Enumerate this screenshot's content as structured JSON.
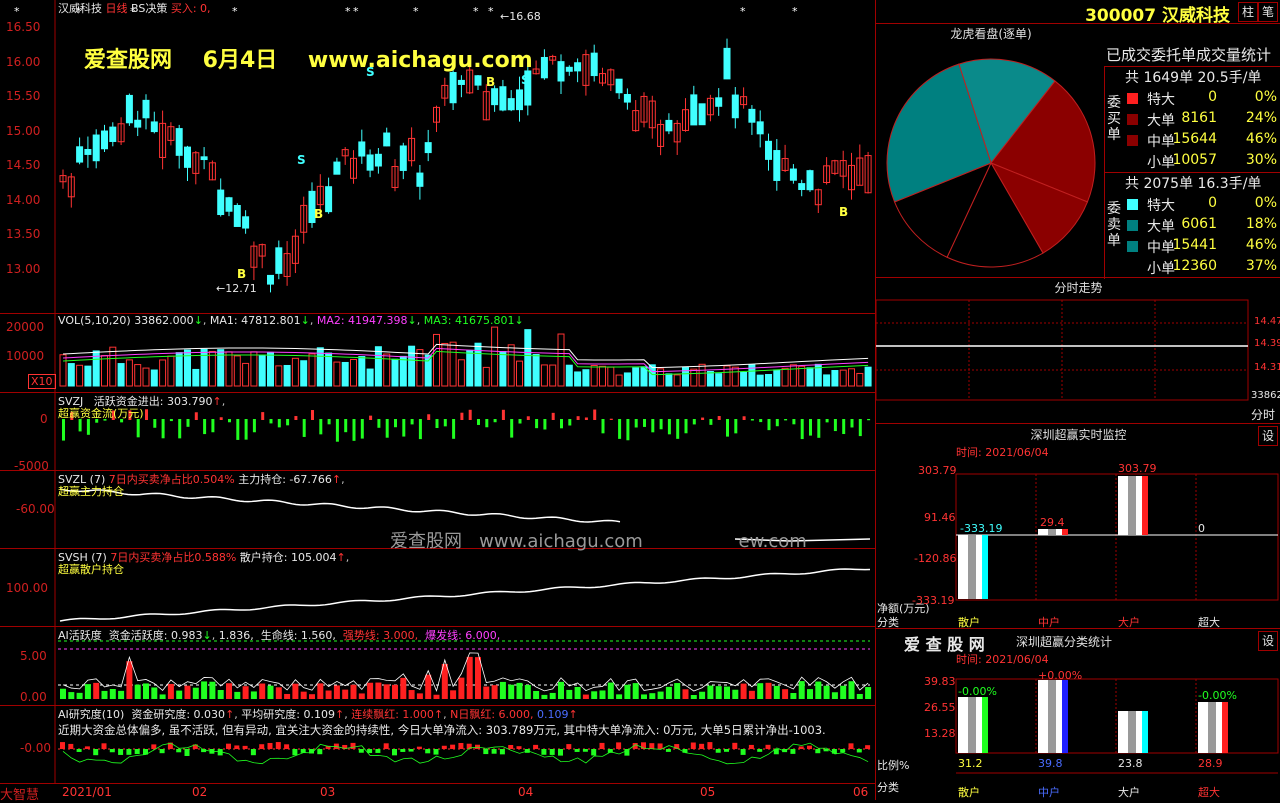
{
  "main_chart": {
    "stock_name": "汉威科技",
    "period": "日线",
    "indicator": "BS决策",
    "buy_label": "买入: 0,",
    "high_marker": "16.68",
    "low_marker": "12.71",
    "y_ticks": [
      "16.50",
      "16.00",
      "15.50",
      "15.00",
      "14.50",
      "14.00",
      "13.50",
      "13.00"
    ],
    "watermark_site": "爱查股网",
    "watermark_date": "6月4日",
    "watermark_url": "www.aichagu.com",
    "signal_b": "B",
    "signal_s": "S"
  },
  "vol_pane": {
    "label": "VOL(5,10,20)",
    "value": "33862.000",
    "ma1": "MA1: 47812.801",
    "ma2": "MA2: 41947.398",
    "ma3": "MA3: 41675.801",
    "y_ticks": [
      "20000",
      "10000"
    ],
    "unit": "X10"
  },
  "svzj_pane": {
    "label": "SVZJ",
    "field": "活跃资金进出: 303.790",
    "sub": "超赢资金流(万元)",
    "y_ticks": [
      "0",
      "-5000"
    ]
  },
  "svzl_pane": {
    "label": "SVZL (7)",
    "field1": "7日内买卖净占比0.504%",
    "field2": "主力持仓: -67.766",
    "sub": "超赢主力持仓",
    "y_ticks": [
      "-60.00"
    ],
    "watermark_site": "爱查股网",
    "watermark_url": "www.aichagu.com",
    "watermark_tail": "ew.com"
  },
  "svsh_pane": {
    "label": "SVSH (7)",
    "field1": "7日内买卖净占比0.588%",
    "field2": "散户持仓: 105.004",
    "sub": "超赢散户持仓",
    "y_ticks": [
      "100.00"
    ]
  },
  "ai_active": {
    "label": "AI活跃度",
    "f1": "资金活跃度: 0.983",
    "f2": "1.836,",
    "f3": "生命线: 1.560,",
    "f4": "强势线: 3.000,",
    "f5": "爆发线: 6.000,",
    "y_ticks": [
      "5.00",
      "0.00"
    ]
  },
  "ai_research": {
    "label": "AI研究度(10)",
    "f1": "资金研究度: 0.030",
    "f2": "平均研究度: 0.109",
    "f3": "连续飘红: 1.000",
    "f4": "N日飘红: 6.000,",
    "f5": "0.109",
    "comment": "近期大资金总体偏多, 虽不活跃, 但有异动, 宜关注大资金的持续性, 今日大单净流入: 303.789万元, 其中特大单净流入: 0万元, 大单5日累计净出-1003.",
    "y_ticks": [
      "-0.00"
    ]
  },
  "x_axis": {
    "brand": "大智慧",
    "labels": [
      "2021/01",
      "02",
      "03",
      "04",
      "05",
      "06"
    ]
  },
  "right_panel": {
    "code": "300007",
    "name": "汉威科技",
    "btn1": "柱",
    "btn2": "笔",
    "lhb_title": "龙虎看盘(逐单)",
    "stat_title": "已成交委托单成交量统计",
    "buy": {
      "side_label": "委买单",
      "summary": "共 1649单 20.5手/单",
      "rows": [
        {
          "name": "特大",
          "value": "0",
          "pct": "0%"
        },
        {
          "name": "大单",
          "value": "8161",
          "pct": "24%"
        },
        {
          "name": "中单",
          "value": "15644",
          "pct": "46%"
        },
        {
          "name": "小单",
          "value": "10057",
          "pct": "30%"
        }
      ]
    },
    "sell": {
      "side_label": "委卖单",
      "summary": "共 2075单 16.3手/单",
      "rows": [
        {
          "name": "特大",
          "value": "0",
          "pct": "0%"
        },
        {
          "name": "大单",
          "value": "6061",
          "pct": "18%"
        },
        {
          "name": "中单",
          "value": "15441",
          "pct": "46%"
        },
        {
          "name": "小单",
          "value": "12360",
          "pct": "37%"
        }
      ]
    },
    "intraday_title": "分时走势",
    "intraday_ticks": [
      "14.47",
      "14.39",
      "14.31"
    ],
    "intraday_vol": "33862",
    "intraday_vol_unit": "分时",
    "monitor_title": "深圳超赢实时监控",
    "monitor_time": "时间: 2021/06/04",
    "monitor_ticks": [
      "303.79",
      "91.46",
      "-120.86",
      "-333.19"
    ],
    "monitor_values": {
      "small": "-333.19",
      "mid": "29.4",
      "large": "303.79",
      "super": "0"
    },
    "monitor_unit": "净额(万元)",
    "category_label": "分类",
    "categories": [
      "散户",
      "中户",
      "大户",
      "超大"
    ],
    "class_title": "深圳超赢分类统计",
    "class_brand": "爱 查 股 网",
    "class_time": "时间: 2021/06/04",
    "class_ticks": [
      "39.83",
      "26.55",
      "13.28"
    ],
    "class_changes": [
      "-0.00%",
      "+0.00%",
      "-0.00%"
    ],
    "class_values": [
      "31.2",
      "39.8",
      "23.8",
      "28.9"
    ],
    "class_ratio_label": "比例%",
    "settings_btn": "设"
  }
}
